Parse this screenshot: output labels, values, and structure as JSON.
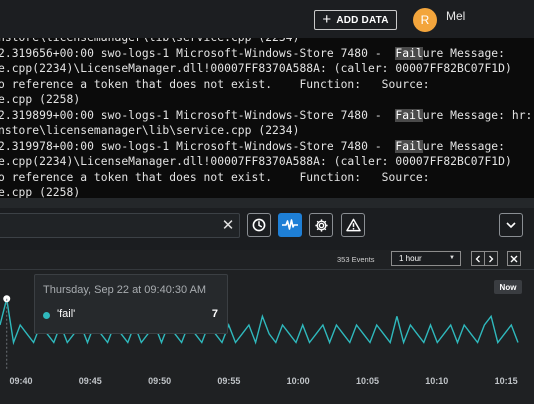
{
  "header": {
    "add_data_label": "ADD DATA",
    "avatar_initial": "R",
    "user_name": "Mel"
  },
  "logs": {
    "lines": [
      {
        "segments": [
          {
            "t": "nstore\\licensemanager\\lib\\service.cpp (2234)"
          }
        ]
      },
      {
        "segments": [
          {
            "t": "2.319656+00:00 swo-logs-1 Microsoft-Windows-Store 7480 -  "
          },
          {
            "t": "Fail",
            "hl": true
          },
          {
            "t": "ure Message:"
          }
        ]
      },
      {
        "segments": [
          {
            "t": "e.cpp(2234)\\LicenseManager.dll!00007FF8370A588A: (caller: 00007FF82BC07F1D)"
          }
        ]
      },
      {
        "segments": [
          {
            "t": "o reference a token that does not exist.    Function:   Source:"
          }
        ]
      },
      {
        "segments": [
          {
            "t": "e.cpp (2258)"
          }
        ]
      },
      {
        "segments": [
          {
            "t": "2.319899+00:00 swo-logs-1 Microsoft-Windows-Store 7480 -  "
          },
          {
            "t": "Fail",
            "hl": true
          },
          {
            "t": "ure Message: hr:"
          }
        ]
      },
      {
        "segments": [
          {
            "t": "nstore\\licensemanager\\lib\\service.cpp (2234)"
          }
        ]
      },
      {
        "segments": [
          {
            "t": "2.319978+00:00 swo-logs-1 Microsoft-Windows-Store 7480 -  "
          },
          {
            "t": "Fail",
            "hl": true
          },
          {
            "t": "ure Message:"
          }
        ]
      },
      {
        "segments": [
          {
            "t": "e.cpp(2234)\\LicenseManager.dll!00007FF8370A588A: (caller: 00007FF82BC07F1D)"
          }
        ]
      },
      {
        "segments": [
          {
            "t": "o reference a token that does not exist.    Function:   Source:"
          }
        ]
      },
      {
        "segments": [
          {
            "t": "e.cpp (2258)"
          }
        ]
      }
    ]
  },
  "search": {
    "value": "",
    "clear_icon": "close-icon"
  },
  "toolbar": {
    "icons": [
      "clock-icon",
      "pulse-icon",
      "gear-icon",
      "warning-icon",
      "chevron-down-icon"
    ]
  },
  "controls": {
    "events_count": "353 Events",
    "range_selected": "1 hour"
  },
  "tooltip": {
    "date": "Thursday, Sep 22 at 09:40:30 AM",
    "series_label": "'fail'",
    "value": "7"
  },
  "now_label": "Now",
  "colors": {
    "series": "#2fb9bd",
    "accent_button": "#1e7fd6",
    "avatar": "#f3a53c"
  },
  "chart_data": {
    "type": "line",
    "x_ticks": [
      "09:40",
      "09:45",
      "09:50",
      "09:55",
      "10:00",
      "10:05",
      "10:10",
      "10:15"
    ],
    "series": [
      {
        "name": "'fail'",
        "values": [
          4,
          7,
          2,
          4,
          3,
          2,
          4,
          3,
          2,
          4,
          2,
          3,
          4,
          2,
          4,
          3,
          2,
          4,
          3,
          2,
          4,
          2,
          3,
          4,
          2,
          4,
          3,
          2,
          4,
          3,
          2,
          4,
          3,
          2,
          4,
          2,
          3,
          4,
          2,
          5,
          3,
          2,
          4,
          3,
          2,
          4,
          2,
          3,
          4,
          2,
          4,
          3,
          2,
          4,
          3,
          2,
          4,
          3,
          2,
          5,
          2,
          4,
          3,
          2,
          4,
          2,
          3,
          4,
          2,
          4,
          3,
          2,
          4,
          5,
          2,
          3,
          4,
          2
        ]
      }
    ],
    "y_range": [
      0,
      8
    ],
    "grid": false,
    "highlighted_point": {
      "x": "09:40:30",
      "value": 7
    }
  }
}
